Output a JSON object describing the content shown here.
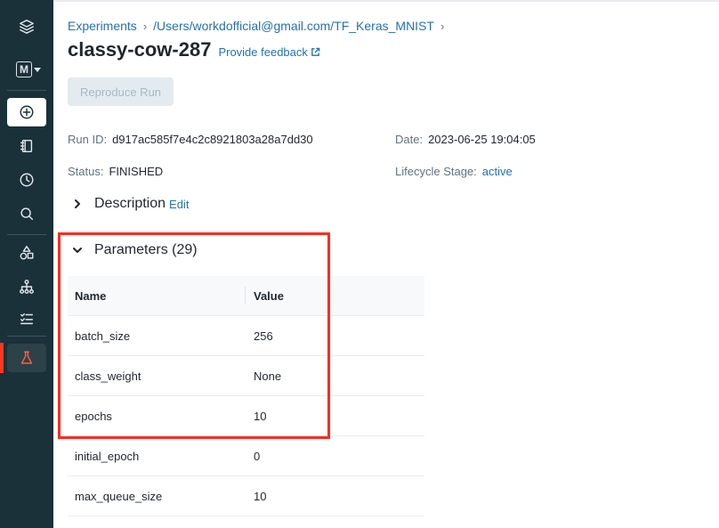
{
  "sidebar": {
    "workspace_letter": "M",
    "icons": [
      "layers-logo-icon",
      "workspace-icon",
      "plus-circle-icon",
      "notebook-icon",
      "clock-icon",
      "search-icon",
      "shapes-icon",
      "tree-icon",
      "checklist-icon",
      "flask-icon"
    ]
  },
  "breadcrumb": {
    "experiments": "Experiments",
    "path": "/Users/workdofficial@gmail.com/TF_Keras_MNIST"
  },
  "run": {
    "title": "classy-cow-287",
    "feedback": "Provide feedback",
    "reproduce": "Reproduce Run"
  },
  "meta": {
    "run_id_label": "Run ID:",
    "run_id": "d917ac585f7e4c2c8921803a28a7dd30",
    "date_label": "Date:",
    "date": "2023-06-25 19:04:05",
    "status_label": "Status:",
    "status": "FINISHED",
    "lifecycle_label": "Lifecycle Stage:",
    "lifecycle": "active"
  },
  "description": {
    "label": "Description",
    "edit": "Edit"
  },
  "parameters": {
    "label": "Parameters (29)",
    "columns": [
      "Name",
      "Value"
    ],
    "rows": [
      [
        "batch_size",
        "256"
      ],
      [
        "class_weight",
        "None"
      ],
      [
        "epochs",
        "10"
      ],
      [
        "initial_epoch",
        "0"
      ],
      [
        "max_queue_size",
        "10"
      ]
    ]
  },
  "colors": {
    "sidebar": "#1b3139",
    "link": "#2272b4",
    "highlight": "#ff2a1f",
    "active": "#ff3621"
  }
}
